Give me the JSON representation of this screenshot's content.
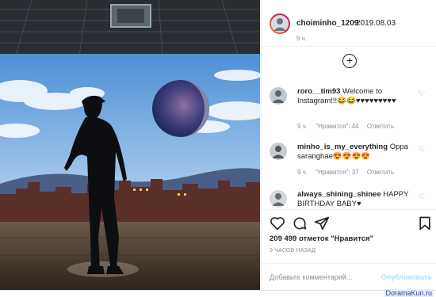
{
  "post": {
    "photo_name": "photo-silhouette-moon",
    "author": {
      "username": "choiminho_1209",
      "date": "2019.08.03",
      "time_ago": "9 ч."
    },
    "load_more_icon": "plus-circle-icon",
    "comments": [
      {
        "username": "roro__tim93",
        "text": "Welcome to Instagram!!!😂😂♥♥♥♥♥♥♥♥♥",
        "time": "9 ч.",
        "likes": "\"Нравится\": 44",
        "reply": "Ответить"
      },
      {
        "username": "minho_is_my_everything",
        "text": "Oppa saranghae😍😍😍😍",
        "time": "9 ч.",
        "likes": "\"Нравится\": 37",
        "reply": "Ответить"
      },
      {
        "username": "always_shining_shinee",
        "text": "HAPPY BIRTHDAY BABY♥",
        "time": "",
        "likes": "",
        "reply": ""
      }
    ],
    "actions": {
      "like_icon": "heart-icon",
      "comment_icon": "comment-bubble-icon",
      "share_icon": "paper-plane-icon",
      "save_icon": "bookmark-icon"
    },
    "likes_text": "209 499 отметок \"Нравится\"",
    "posted_ago": "9 ЧАСОВ НАЗАД",
    "add_comment": {
      "placeholder": "Добавьте комментарий...",
      "publish": "Опубликовать"
    }
  },
  "watermark": "DoramaKun.ru",
  "colors": {
    "border": "#dbdbdb",
    "muted": "#8e8e8e",
    "text": "#262626",
    "publish_disabled": "#b2dffc"
  }
}
